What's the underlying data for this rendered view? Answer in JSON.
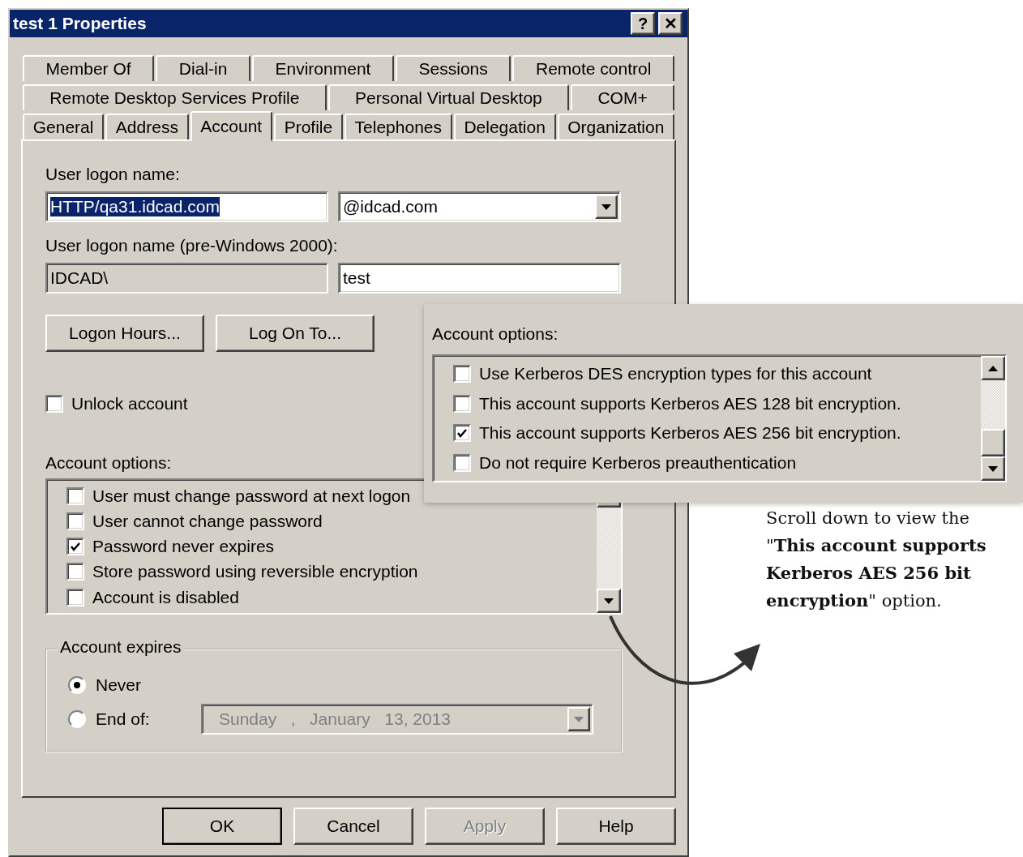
{
  "window": {
    "title": "test 1 Properties",
    "title_buttons": [
      "?",
      "✕"
    ]
  },
  "tab_rows": [
    [
      {
        "label": "Member Of",
        "selected": false
      },
      {
        "label": "Dial-in",
        "selected": false
      },
      {
        "label": "Environment",
        "selected": false
      },
      {
        "label": "Sessions",
        "selected": false
      },
      {
        "label": "Remote control",
        "selected": false
      }
    ],
    [
      {
        "label": "Remote Desktop Services Profile",
        "selected": false
      },
      {
        "label": "Personal Virtual Desktop",
        "selected": false
      },
      {
        "label": "COM+",
        "selected": false
      }
    ],
    [
      {
        "label": "General",
        "selected": false
      },
      {
        "label": "Address",
        "selected": false
      },
      {
        "label": "Account",
        "selected": true
      },
      {
        "label": "Profile",
        "selected": false
      },
      {
        "label": "Telephones",
        "selected": false
      },
      {
        "label": "Delegation",
        "selected": false
      },
      {
        "label": "Organization",
        "selected": false
      }
    ]
  ],
  "user_logon_name": {
    "label": "User logon name:",
    "value": "HTTP/qa31.idcad.com",
    "highlighted": true,
    "domain": "@idcad.com"
  },
  "pre_windows_logon": {
    "label": "User logon name (pre-Windows 2000):",
    "domain": "IDCAD\\",
    "value": "test"
  },
  "logon_buttons": [
    "Logon Hours...",
    "Log On To..."
  ],
  "unlock_account": {
    "label": "Unlock account",
    "checked": false
  },
  "account_options": {
    "label": "Account options:",
    "items": [
      {
        "label": "User must change password at next logon",
        "checked": false
      },
      {
        "label": "User cannot change password",
        "checked": false
      },
      {
        "label": "Password never expires",
        "checked": true
      },
      {
        "label": "Store password using reversible encryption",
        "checked": false
      },
      {
        "label": "Account is disabled",
        "checked": false
      }
    ]
  },
  "account_expires": {
    "legend": "Account expires",
    "options": [
      {
        "label": "Never",
        "selected": true
      },
      {
        "label": "End of:",
        "selected": false
      }
    ],
    "date": "Sunday   ,   January   13, 2013",
    "date_disabled": true
  },
  "dialog_buttons": [
    {
      "label": "OK",
      "disabled": false,
      "default": true
    },
    {
      "label": "Cancel",
      "disabled": false,
      "default": false
    },
    {
      "label": "Apply",
      "disabled": true,
      "default": false
    },
    {
      "label": "Help",
      "disabled": false,
      "default": false
    }
  ],
  "callout": {
    "label": "Account options:",
    "items": [
      {
        "label": "Use Kerberos DES encryption types for this account",
        "checked": false
      },
      {
        "label": "This account supports Kerberos AES 128 bit encryption.",
        "checked": false
      },
      {
        "label": "This account supports Kerberos AES 256 bit encryption.",
        "checked": true
      },
      {
        "label": "Do not require Kerberos preauthentication",
        "checked": false
      }
    ]
  },
  "annotation": "Scroll down to view the \"**This account supports Kerberos AES 256 bit encryption**\" option."
}
